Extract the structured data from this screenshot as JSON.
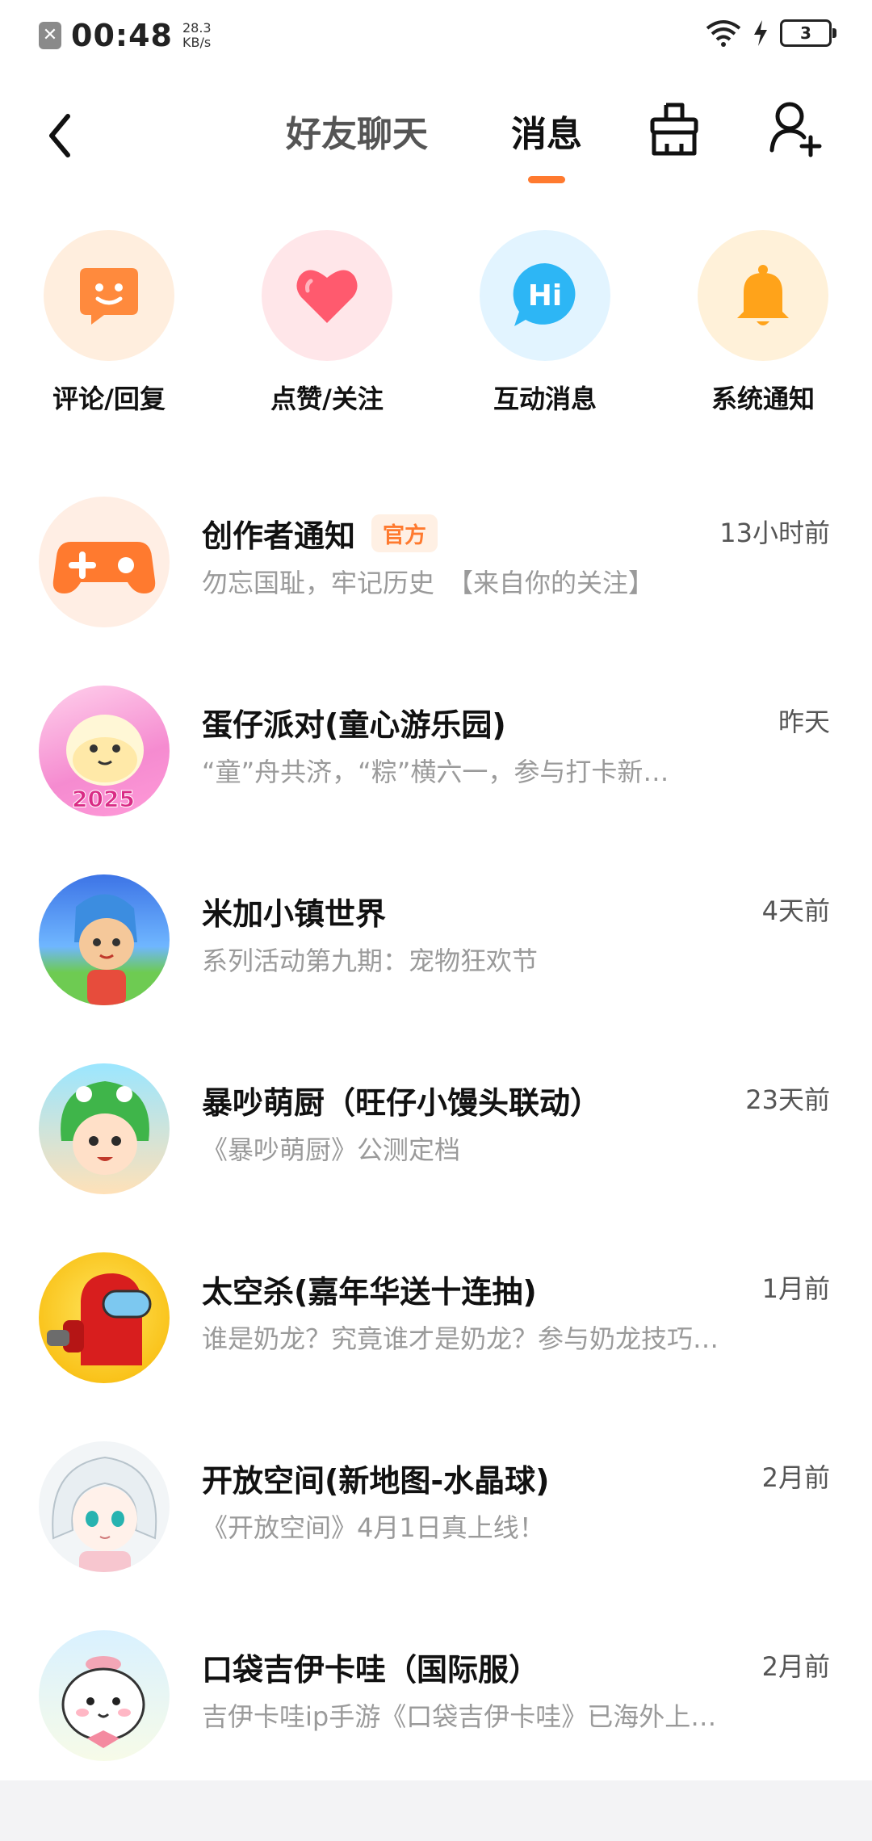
{
  "status_bar": {
    "notif_glyph": "✕",
    "time": "00:48",
    "speed_value": "28.3",
    "speed_unit": "KB/s",
    "battery_level": "3"
  },
  "nav": {
    "tabs": [
      {
        "label": "好友聊天",
        "active": false
      },
      {
        "label": "消息",
        "active": true
      }
    ],
    "accent_color": "#ff7a2f"
  },
  "categories": [
    {
      "label": "评论/回复",
      "icon": "comment-face-icon",
      "bg": "#ffeede",
      "color": "#ff8a3d"
    },
    {
      "label": "点赞/关注",
      "icon": "heart-icon",
      "bg": "#ffe6e9",
      "color": "#ff5a6e"
    },
    {
      "label": "互动消息",
      "icon": "hi-bubble-icon",
      "bg": "#e2f4ff",
      "color": "#2db6f5",
      "icon_text": "Hi"
    },
    {
      "label": "系统通知",
      "icon": "bell-icon",
      "bg": "#fff1d9",
      "color": "#ffa31a"
    }
  ],
  "messages": [
    {
      "name": "创作者通知",
      "tag": "官方",
      "time": "13小时前",
      "preview": "勿忘国耻，牢记历史　【来自你的关注】",
      "avatar": "gamepad-avatar"
    },
    {
      "name": "蛋仔派对(童心游乐园)",
      "tag": "",
      "time": "昨天",
      "preview": "“童”舟共济，“粽”横六一，参与打卡新…",
      "avatar": "eggy-party-avatar",
      "avatar_text": "2025"
    },
    {
      "name": "米加小镇世界",
      "tag": "",
      "time": "4天前",
      "preview": "系列活动第九期：宠物狂欢节",
      "avatar": "miga-town-avatar"
    },
    {
      "name": "暴吵萌厨（旺仔小馒头联动）",
      "tag": "",
      "time": "23天前",
      "preview": "《暴吵萌厨》公测定档",
      "avatar": "cooking-game-avatar"
    },
    {
      "name": "太空杀(嘉年华送十连抽)",
      "tag": "",
      "time": "1月前",
      "preview": "谁是奶龙？究竟谁才是奶龙？参与奶龙技巧…",
      "avatar": "space-kill-avatar"
    },
    {
      "name": "开放空间(新地图-水晶球)",
      "tag": "",
      "time": "2月前",
      "preview": "《开放空间》4月1日真上线！",
      "avatar": "open-space-avatar"
    },
    {
      "name": "口袋吉伊卡哇（国际服）",
      "tag": "",
      "time": "2月前",
      "preview": "吉伊卡哇ip手游《口袋吉伊卡哇》已海外上…",
      "avatar": "chiikawa-avatar"
    }
  ]
}
